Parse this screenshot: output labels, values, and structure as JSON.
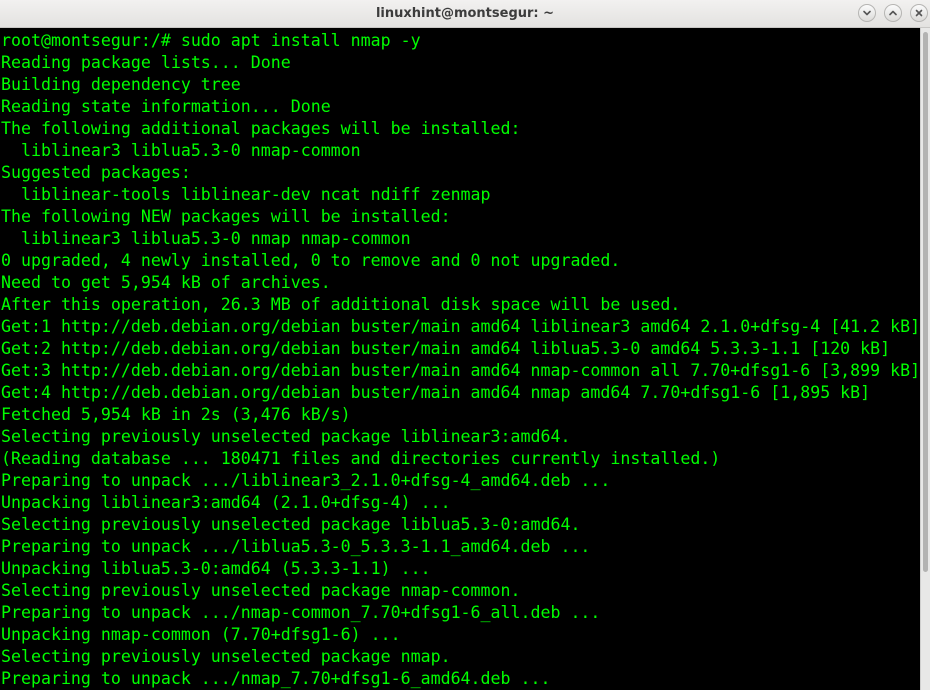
{
  "window": {
    "title": "linuxhint@montsegur: ~"
  },
  "icons": {
    "minimize": "chevron-down-icon",
    "maximize": "chevron-up-icon",
    "close": "close-icon"
  },
  "colors": {
    "terminal_bg": "#000000",
    "terminal_fg": "#00ff00",
    "titlebar_bg": "#eeeeec"
  },
  "terminal": {
    "lines": [
      "root@montsegur:/# sudo apt install nmap -y",
      "Reading package lists... Done",
      "Building dependency tree",
      "Reading state information... Done",
      "The following additional packages will be installed:",
      "  liblinear3 liblua5.3-0 nmap-common",
      "Suggested packages:",
      "  liblinear-tools liblinear-dev ncat ndiff zenmap",
      "The following NEW packages will be installed:",
      "  liblinear3 liblua5.3-0 nmap nmap-common",
      "0 upgraded, 4 newly installed, 0 to remove and 0 not upgraded.",
      "Need to get 5,954 kB of archives.",
      "After this operation, 26.3 MB of additional disk space will be used.",
      "Get:1 http://deb.debian.org/debian buster/main amd64 liblinear3 amd64 2.1.0+dfsg-4 [41.2 kB]",
      "Get:2 http://deb.debian.org/debian buster/main amd64 liblua5.3-0 amd64 5.3.3-1.1 [120 kB]",
      "Get:3 http://deb.debian.org/debian buster/main amd64 nmap-common all 7.70+dfsg1-6 [3,899 kB]",
      "Get:4 http://deb.debian.org/debian buster/main amd64 nmap amd64 7.70+dfsg1-6 [1,895 kB]",
      "Fetched 5,954 kB in 2s (3,476 kB/s)",
      "Selecting previously unselected package liblinear3:amd64.",
      "(Reading database ... 180471 files and directories currently installed.)",
      "Preparing to unpack .../liblinear3_2.1.0+dfsg-4_amd64.deb ...",
      "Unpacking liblinear3:amd64 (2.1.0+dfsg-4) ...",
      "Selecting previously unselected package liblua5.3-0:amd64.",
      "Preparing to unpack .../liblua5.3-0_5.3.3-1.1_amd64.deb ...",
      "Unpacking liblua5.3-0:amd64 (5.3.3-1.1) ...",
      "Selecting previously unselected package nmap-common.",
      "Preparing to unpack .../nmap-common_7.70+dfsg1-6_all.deb ...",
      "Unpacking nmap-common (7.70+dfsg1-6) ...",
      "Selecting previously unselected package nmap.",
      "Preparing to unpack .../nmap_7.70+dfsg1-6_amd64.deb ..."
    ]
  }
}
